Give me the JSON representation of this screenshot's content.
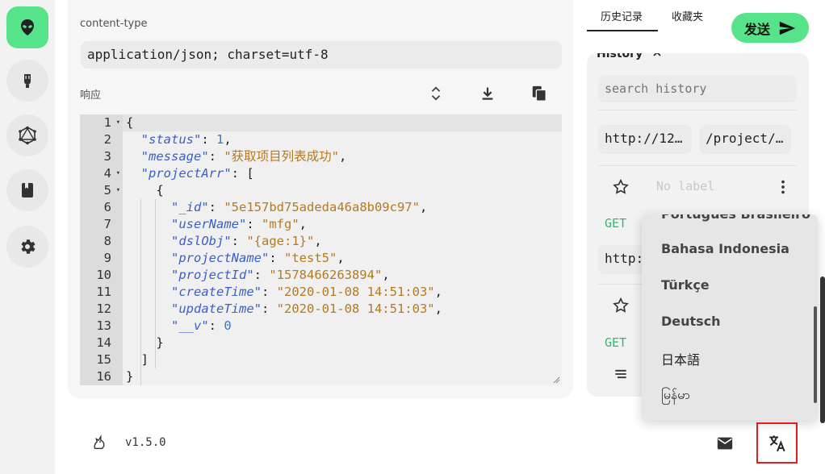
{
  "main": {
    "content_type_label": "content-type",
    "content_type_value": "application/json; charset=utf-8",
    "response_label": "响应"
  },
  "editor": {
    "line_numbers": [
      "1",
      "2",
      "3",
      "4",
      "5",
      "6",
      "7",
      "8",
      "9",
      "10",
      "11",
      "12",
      "13",
      "14",
      "15",
      "16"
    ],
    "fold_markers": [
      1,
      4,
      5
    ],
    "lines": [
      [
        {
          "t": "p",
          "v": "{"
        }
      ],
      [
        {
          "t": "p",
          "v": "  "
        },
        {
          "t": "k",
          "v": "\"status\""
        },
        {
          "t": "p",
          "v": ": "
        },
        {
          "t": "n",
          "v": "1"
        },
        {
          "t": "p",
          "v": ","
        }
      ],
      [
        {
          "t": "p",
          "v": "  "
        },
        {
          "t": "k",
          "v": "\"message\""
        },
        {
          "t": "p",
          "v": ": "
        },
        {
          "t": "s",
          "v": "\"获取项目列表成功\""
        },
        {
          "t": "p",
          "v": ","
        }
      ],
      [
        {
          "t": "p",
          "v": "  "
        },
        {
          "t": "k",
          "v": "\"projectArr\""
        },
        {
          "t": "p",
          "v": ": ["
        }
      ],
      [
        {
          "t": "p",
          "v": "    {"
        }
      ],
      [
        {
          "t": "p",
          "v": "      "
        },
        {
          "t": "k",
          "v": "\"_id\""
        },
        {
          "t": "p",
          "v": ": "
        },
        {
          "t": "s",
          "v": "\"5e157bd75adeda46a8b09c97\""
        },
        {
          "t": "p",
          "v": ","
        }
      ],
      [
        {
          "t": "p",
          "v": "      "
        },
        {
          "t": "k",
          "v": "\"userName\""
        },
        {
          "t": "p",
          "v": ": "
        },
        {
          "t": "s",
          "v": "\"mfg\""
        },
        {
          "t": "p",
          "v": ","
        }
      ],
      [
        {
          "t": "p",
          "v": "      "
        },
        {
          "t": "k",
          "v": "\"dslObj\""
        },
        {
          "t": "p",
          "v": ": "
        },
        {
          "t": "s",
          "v": "\"{age:1}\""
        },
        {
          "t": "p",
          "v": ","
        }
      ],
      [
        {
          "t": "p",
          "v": "      "
        },
        {
          "t": "k",
          "v": "\"projectName\""
        },
        {
          "t": "p",
          "v": ": "
        },
        {
          "t": "s",
          "v": "\"test5\""
        },
        {
          "t": "p",
          "v": ","
        }
      ],
      [
        {
          "t": "p",
          "v": "      "
        },
        {
          "t": "k",
          "v": "\"projectId\""
        },
        {
          "t": "p",
          "v": ": "
        },
        {
          "t": "s",
          "v": "\"1578466263894\""
        },
        {
          "t": "p",
          "v": ","
        }
      ],
      [
        {
          "t": "p",
          "v": "      "
        },
        {
          "t": "k",
          "v": "\"createTime\""
        },
        {
          "t": "p",
          "v": ": "
        },
        {
          "t": "s",
          "v": "\"2020-01-08 14:51:03\""
        },
        {
          "t": "p",
          "v": ","
        }
      ],
      [
        {
          "t": "p",
          "v": "      "
        },
        {
          "t": "k",
          "v": "\"updateTime\""
        },
        {
          "t": "p",
          "v": ": "
        },
        {
          "t": "s",
          "v": "\"2020-01-08 14:51:03\""
        },
        {
          "t": "p",
          "v": ","
        }
      ],
      [
        {
          "t": "p",
          "v": "      "
        },
        {
          "t": "k",
          "v": "\"__v\""
        },
        {
          "t": "p",
          "v": ": "
        },
        {
          "t": "n",
          "v": "0"
        }
      ],
      [
        {
          "t": "p",
          "v": "    }"
        }
      ],
      [
        {
          "t": "p",
          "v": "  ]"
        }
      ],
      [
        {
          "t": "p",
          "v": "}"
        }
      ]
    ]
  },
  "tabs": [
    {
      "label": "历史记录",
      "active": true
    },
    {
      "label": "收藏夹",
      "active": false
    }
  ],
  "send_button": {
    "label": "发送"
  },
  "history": {
    "title": "History",
    "search_placeholder": "search history",
    "url_host": "http://12…",
    "url_path": "/project/…",
    "no_label": "No label",
    "method": "GET",
    "url_host_2": "http:",
    "method_2": "GET"
  },
  "language_menu": {
    "items": [
      "Português Brasileiro",
      "Bahasa Indonesia",
      "Türkçe",
      "Deutsch",
      "日本語",
      "မြန်မာ"
    ]
  },
  "footer": {
    "version": "v1.5.0"
  },
  "colors": {
    "accent": "#57e389",
    "highlight_border": "#e02020"
  }
}
